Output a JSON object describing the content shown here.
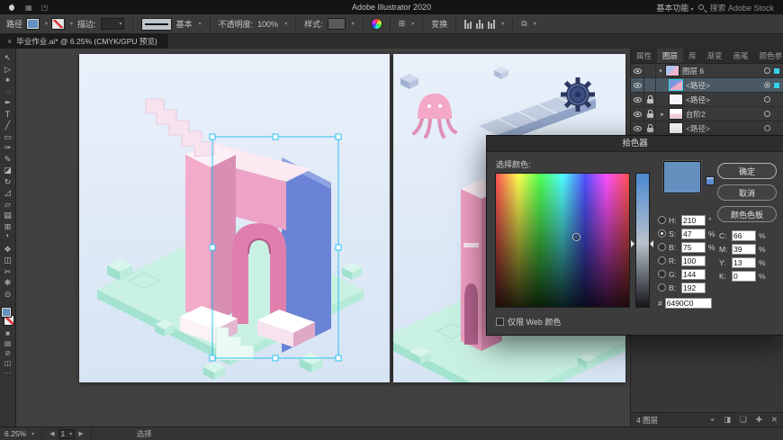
{
  "menu_bar": {
    "title": "Adobe Illustrator 2020",
    "workspace_label": "基本功能",
    "search_label": "搜索 Adobe Stock"
  },
  "control_bar": {
    "selection_type": "路径",
    "stroke_label": "描边:",
    "brush_name": "基本",
    "opacity_label": "不透明度:",
    "opacity_value": "100%",
    "style_label": "样式:",
    "transform_label": "变换"
  },
  "document_tab": {
    "close": "×",
    "title": "毕业作业.ai* @ 6.25% (CMYK/GPU 预览)"
  },
  "tools": [
    {
      "name": "selection",
      "glyph": "↖"
    },
    {
      "name": "direct-selection",
      "glyph": "▷"
    },
    {
      "name": "magic-wand",
      "glyph": "✶"
    },
    {
      "name": "lasso",
      "glyph": "◌"
    },
    {
      "name": "pen",
      "glyph": "✒"
    },
    {
      "name": "type",
      "glyph": "T"
    },
    {
      "name": "line-segment",
      "glyph": "╱"
    },
    {
      "name": "rectangle",
      "glyph": "▭"
    },
    {
      "name": "paintbrush",
      "glyph": "✑"
    },
    {
      "name": "pencil",
      "glyph": "✎"
    },
    {
      "name": "eraser",
      "glyph": "◪"
    },
    {
      "name": "rotate",
      "glyph": "↻"
    },
    {
      "name": "scale",
      "glyph": "◿"
    },
    {
      "name": "free-transform",
      "glyph": "▱"
    },
    {
      "name": "gradient",
      "glyph": "▤"
    },
    {
      "name": "mesh",
      "glyph": "⊞"
    },
    {
      "name": "eyedropper",
      "glyph": "❜"
    },
    {
      "name": "blend",
      "glyph": "❖"
    },
    {
      "name": "artboard",
      "glyph": "◫"
    },
    {
      "name": "slice",
      "glyph": "✂"
    },
    {
      "name": "hand",
      "glyph": "❋"
    },
    {
      "name": "zoom",
      "glyph": "⊙"
    }
  ],
  "toolbar_modes": [
    "■",
    "▤",
    "⊘"
  ],
  "toolbar_more": "⋯",
  "color_picker": {
    "title": "拾色器",
    "select_color_label": "选择颜色:",
    "buttons": {
      "ok": "确定",
      "cancel": "取消",
      "swatches": "颜色色板"
    },
    "web_only_label": "仅限 Web 颜色",
    "preview_color": "#6490c0",
    "hsb": [
      {
        "label": "H:",
        "value": "210",
        "unit": "°",
        "selected": false
      },
      {
        "label": "S:",
        "value": "47",
        "unit": "%",
        "selected": true
      },
      {
        "label": "B:",
        "value": "75",
        "unit": "%",
        "selected": false
      }
    ],
    "rgb": [
      {
        "label": "R:",
        "value": "100",
        "unit": ""
      },
      {
        "label": "G:",
        "value": "144",
        "unit": ""
      },
      {
        "label": "B:",
        "value": "192",
        "unit": ""
      }
    ],
    "hex_label": "#",
    "hex_value": "6490C0",
    "cmyk": [
      {
        "label": "C:",
        "value": "66",
        "unit": "%"
      },
      {
        "label": "M:",
        "value": "39",
        "unit": "%"
      },
      {
        "label": "Y:",
        "value": "13",
        "unit": "%"
      },
      {
        "label": "K:",
        "value": "0",
        "unit": "%"
      }
    ]
  },
  "right_panel": {
    "tabs": [
      "属性",
      "图层",
      "库"
    ],
    "tabs_secondary": [
      "渐变",
      "画笔",
      "颜色参"
    ],
    "active_tab": "图层",
    "layers": [
      {
        "name": "图层 6",
        "locked": false,
        "expanded": true,
        "selected": false
      },
      {
        "name": "<路径>",
        "locked": false,
        "selected": true
      },
      {
        "name": "<路径>",
        "locked": true,
        "selected": false
      },
      {
        "name": "台阶2",
        "locked": true,
        "expandable": true,
        "selected": false
      },
      {
        "name": "<路径>",
        "locked": true,
        "selected": false
      }
    ],
    "footer_count": "4 图层",
    "footer_icons": [
      "⌖",
      "◨",
      "❏",
      "✚",
      "✕"
    ]
  },
  "status_bar": {
    "zoom": "6.25%",
    "artboard_number": "1",
    "tool_hint": "选择"
  }
}
